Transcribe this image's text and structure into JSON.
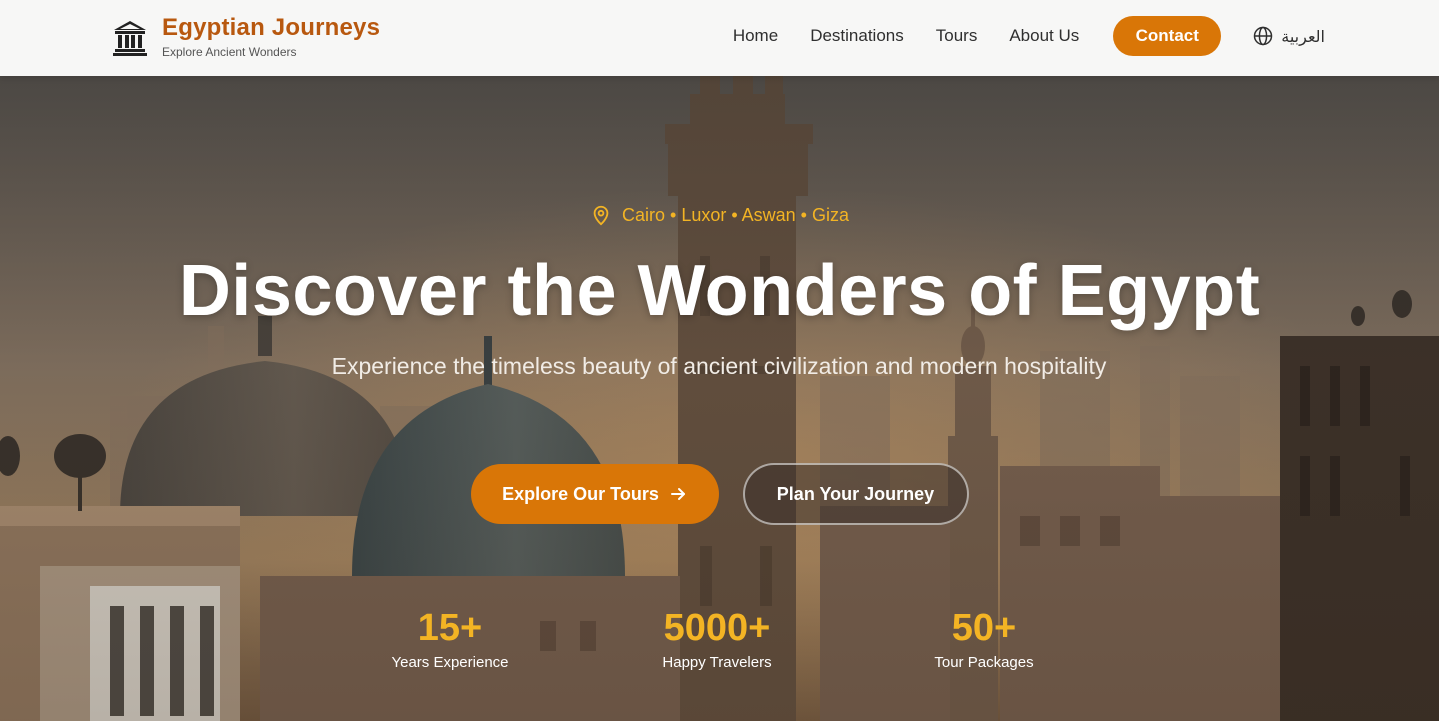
{
  "brand": {
    "name": "Egyptian Journeys",
    "tagline": "Explore Ancient Wonders"
  },
  "nav": {
    "links": [
      "Home",
      "Destinations",
      "Tours",
      "About Us"
    ],
    "contact_label": "Contact",
    "language_label": "العربية"
  },
  "hero": {
    "locations": "Cairo • Luxor • Aswan • Giza",
    "title": "Discover the Wonders of Egypt",
    "subtitle": "Experience the timeless beauty of ancient civilization and modern hospitality",
    "primary_cta": "Explore Our Tours",
    "secondary_cta": "Plan Your Journey"
  },
  "stats": [
    {
      "value": "15+",
      "label": "Years Experience"
    },
    {
      "value": "5000+",
      "label": "Happy Travelers"
    },
    {
      "value": "50+",
      "label": "Tour Packages"
    }
  ],
  "colors": {
    "accent": "#d97607",
    "brand": "#b8580f",
    "highlight": "#f3b424"
  }
}
